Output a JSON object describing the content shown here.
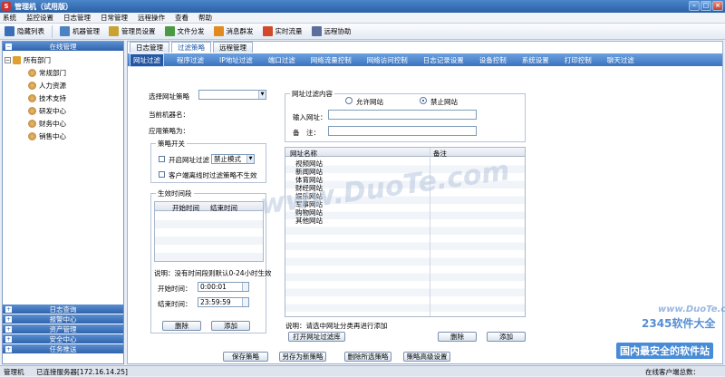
{
  "window": {
    "title": "管理机（试用版）"
  },
  "menu": [
    "系统",
    "监控设置",
    "日志管理",
    "日常管理",
    "远程操作",
    "查看",
    "帮助"
  ],
  "toolbar": [
    {
      "label": "隐藏列表",
      "icon": "list-icon",
      "color": "#3a6fb8"
    },
    {
      "label": "机器管理",
      "icon": "computer-icon",
      "color": "#4b82c4"
    },
    {
      "label": "管理员设置",
      "icon": "admin-icon",
      "color": "#c9a230"
    },
    {
      "label": "文件分发",
      "icon": "file-icon",
      "color": "#4a9a42"
    },
    {
      "label": "消息群发",
      "icon": "message-icon",
      "color": "#e08a20"
    },
    {
      "label": "实时流量",
      "icon": "traffic-icon",
      "color": "#d04a2a"
    },
    {
      "label": "远程协助",
      "icon": "remote-icon",
      "color": "#5a6f9c"
    }
  ],
  "left": {
    "header": "在线管理",
    "root": "所有部门",
    "departments": [
      "常规部门",
      "人力资源",
      "技术支持",
      "研发中心",
      "财务中心",
      "销售中心"
    ],
    "bottom": [
      "日志查询",
      "报警中心",
      "资产管理",
      "安全中心",
      "任务推送"
    ]
  },
  "tabs1": [
    "日志管理",
    "过滤策略",
    "远程管理"
  ],
  "tabs2": [
    "网址过滤",
    "程序过滤",
    "IP地址过滤",
    "端口过滤",
    "网络流量控制",
    "网络访问控制",
    "日志记录设置",
    "设备控制",
    "系统设置",
    "打印控制",
    "聊天过滤"
  ],
  "policy": {
    "select_label": "选择网址策略",
    "select_value": "",
    "machine_label": "当前机器名：",
    "applied_label": "应用策略为：",
    "switch_group": "策略开关",
    "enable_label": "开启网址过滤",
    "enable_mode": "禁止模式",
    "offline_label": "客户端离线时过滤策略不生效",
    "time_group": "生效时间段",
    "time_cols": [
      "开始时间",
      "结束时间"
    ],
    "time_note": "说明：没有时间段则默认0-24小时生效",
    "start_label": "开始时间：",
    "start_value": "0:00:01",
    "end_label": "结束时间：",
    "end_value": "23:59:59",
    "delete": "删除",
    "add": "添加"
  },
  "filter": {
    "group": "网址过滤内容",
    "allow": "允许网站",
    "deny": "禁止网站",
    "url_label": "输入网址：",
    "note_label": "备　注：",
    "cols": [
      "网址名称",
      "备注"
    ],
    "rows": [
      "视频网站",
      "新闻网站",
      "体育网站",
      "财经网站",
      "娱乐网站",
      "军事网站",
      "购物网站",
      "其他网站"
    ],
    "tip": "说明：请选中网址分类再进行添加",
    "open_lib": "打开网址过滤库",
    "delete": "删除",
    "add": "添加"
  },
  "actions": [
    "保存策略",
    "另存为新策略",
    "删除所选策略",
    "策略高级设置"
  ],
  "status": {
    "left": "管理机",
    "server": "已连接服务器[172.16.14.25]",
    "right": "在线客户端总数："
  },
  "watermarks": {
    "a": "www.DuoTe.com",
    "b": "2345软件大全",
    "c": "国内最安全的软件站",
    "d": "www.DuoTe.com"
  }
}
